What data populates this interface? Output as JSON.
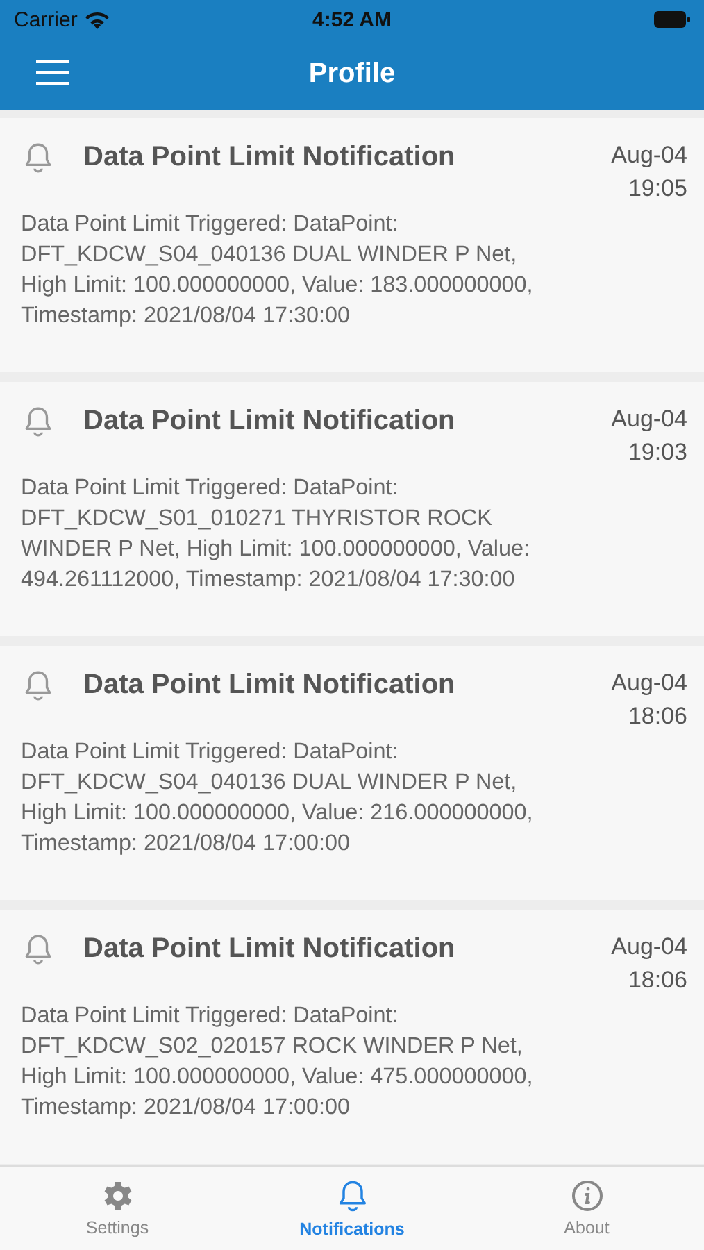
{
  "status_bar": {
    "carrier": "Carrier",
    "time": "4:52 AM"
  },
  "nav_bar": {
    "title": "Profile"
  },
  "notifications": [
    {
      "title": "Data Point Limit Notification",
      "date": "Aug-04",
      "time": "19:05",
      "message": "Data Point Limit Triggered: DataPoint: DFT_KDCW_S04_040136 DUAL WINDER P Net, High Limit: 100.000000000, Value: 183.000000000, Timestamp: 2021/08/04 17:30:00"
    },
    {
      "title": "Data Point Limit Notification",
      "date": "Aug-04",
      "time": "19:03",
      "message": "Data Point Limit Triggered: DataPoint: DFT_KDCW_S01_010271 THYRISTOR ROCK WINDER P Net, High Limit: 100.000000000, Value: 494.261112000, Timestamp: 2021/08/04 17:30:00"
    },
    {
      "title": "Data Point Limit Notification",
      "date": "Aug-04",
      "time": "18:06",
      "message": "Data Point Limit Triggered: DataPoint: DFT_KDCW_S04_040136 DUAL WINDER P Net, High Limit: 100.000000000, Value: 216.000000000, Timestamp: 2021/08/04 17:00:00"
    },
    {
      "title": "Data Point Limit Notification",
      "date": "Aug-04",
      "time": "18:06",
      "message": "Data Point Limit Triggered: DataPoint: DFT_KDCW_S02_020157 ROCK WINDER P Net, High Limit: 100.000000000, Value: 475.000000000, Timestamp: 2021/08/04 17:00:00"
    }
  ],
  "tab_bar": [
    {
      "label": "Settings",
      "kind": "gear",
      "selected": false
    },
    {
      "label": "Notifications",
      "kind": "bell",
      "selected": true
    },
    {
      "label": "About",
      "kind": "info",
      "selected": false
    }
  ]
}
